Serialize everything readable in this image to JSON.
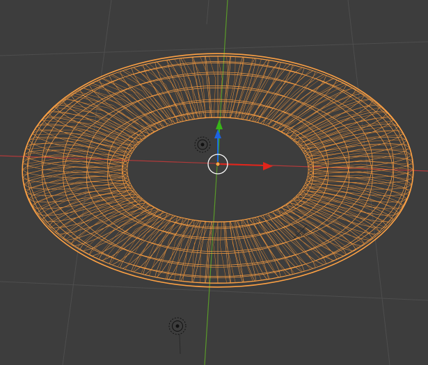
{
  "app": "3D Viewport",
  "colors": {
    "background": "#3d3d3d",
    "grid": "#4e4e4e",
    "x_axis": "#b33a3a",
    "y_axis": "#5a9a2a",
    "selection": "#ffa244",
    "selection_dark": "#d9802a",
    "gizmo_x": "#e0251b",
    "gizmo_y": "#38b518",
    "gizmo_z": "#1d64e0",
    "cursor_white": "#ffffff",
    "cursor_red": "#ff3b3b",
    "origin": "#ffa244"
  },
  "scene": {
    "selected_object": "torus-mesh",
    "display_mode": "wireframe",
    "objects": [
      {
        "name": "torus-wireframe",
        "selected": true
      },
      {
        "name": "light-object",
        "selected": false
      },
      {
        "name": "light-object",
        "selected": false
      }
    ],
    "transform_gizmo": {
      "axes": [
        "x",
        "y",
        "z"
      ]
    }
  }
}
